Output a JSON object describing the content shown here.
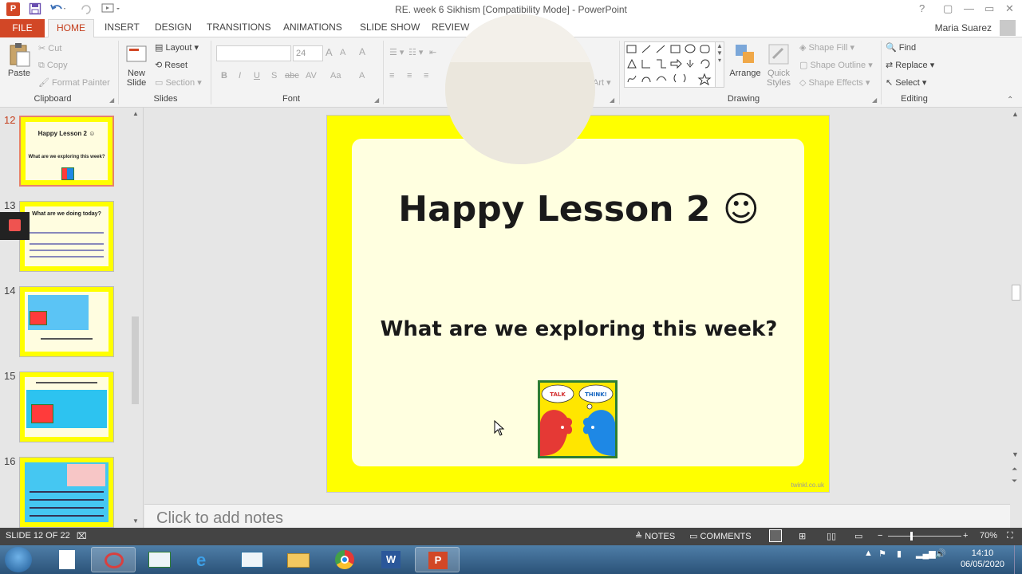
{
  "app": {
    "title": "RE. week 6 Sikhism [Compatibility Mode] - PowerPoint",
    "icon_letter": "P",
    "user": "Maria Suarez",
    "window_controls": [
      "?",
      "▢",
      "—",
      "▭",
      "✕"
    ]
  },
  "tabs": [
    {
      "label": "FILE"
    },
    {
      "label": "HOME"
    },
    {
      "label": "INSERT"
    },
    {
      "label": "DESIGN"
    },
    {
      "label": "TRANSITIONS"
    },
    {
      "label": "ANIMATIONS"
    },
    {
      "label": "SLIDE SHOW"
    },
    {
      "label": "REVIEW"
    }
  ],
  "ribbon": {
    "clipboard": {
      "paste": "Paste",
      "cut": "Cut",
      "copy": "Copy",
      "format_painter": "Format Painter",
      "label": "Clipboard"
    },
    "slides": {
      "new_slide": "New",
      "new_slide2": "Slide",
      "layout": "Layout",
      "reset": "Reset",
      "section": "Section",
      "label": "Slides"
    },
    "font": {
      "size": "24",
      "bold": "B",
      "italic": "I",
      "underline": "U",
      "shadow": "S",
      "strike": "abc",
      "spacing": "AV",
      "case": "Aa",
      "color": "A",
      "label": "Font"
    },
    "paragraph": {
      "art": "Art"
    },
    "drawing": {
      "arrange": "Arrange",
      "quick_styles": "Quick",
      "quick_styles2": "Styles",
      "shape_fill": "Shape Fill",
      "shape_outline": "Shape Outline",
      "shape_effects": "Shape Effects",
      "label": "Drawing"
    },
    "editing": {
      "find": "Find",
      "replace": "Replace",
      "select": "Select",
      "label": "Editing"
    }
  },
  "thumbnails": [
    {
      "num": "12",
      "title": "Happy Lesson 2 ☺",
      "subtitle": "What are we exploring this week?"
    },
    {
      "num": "13",
      "title": "What are we doing today?"
    },
    {
      "num": "14"
    },
    {
      "num": "15"
    },
    {
      "num": "16"
    }
  ],
  "slide": {
    "title": "Happy Lesson 2 ☺",
    "subtitle": "What are we exploring this week?",
    "credit": "twinkl.co.uk",
    "pic_talk": "TALK",
    "pic_think": "THINK!"
  },
  "notes": {
    "placeholder": "Click to add notes"
  },
  "status": {
    "slide_indicator": "SLIDE 12 OF 22",
    "notes": "NOTES",
    "comments": "COMMENTS",
    "zoom": "70%"
  },
  "taskbar": {
    "time": "14:10",
    "date": "06/05/2020"
  }
}
